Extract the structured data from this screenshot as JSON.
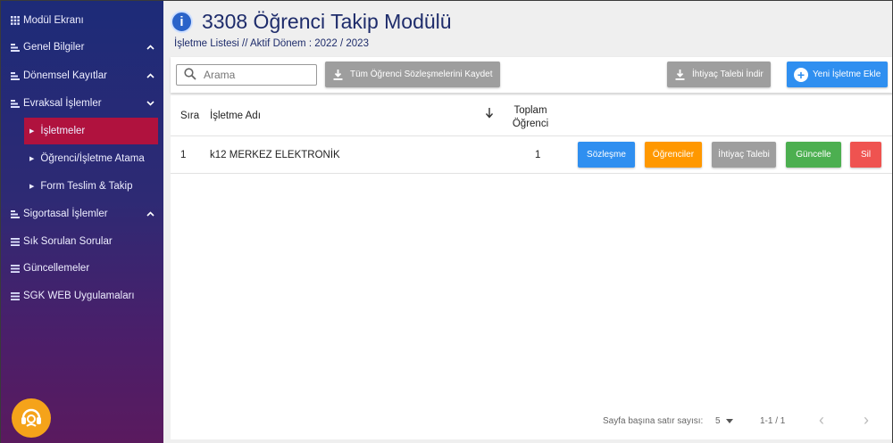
{
  "sidebar": {
    "items": [
      {
        "label": "Modül Ekranı",
        "icon": "grid-icon",
        "chevron": ""
      },
      {
        "label": "Genel Bilgiler",
        "icon": "list-icon",
        "chevron": "up"
      },
      {
        "label": "Dönemsel Kayıtlar",
        "icon": "list-icon",
        "chevron": "up"
      },
      {
        "label": "Evraksal İşlemler",
        "icon": "list-icon",
        "chevron": "down"
      }
    ],
    "subitems": [
      {
        "label": "İşletmeler",
        "active": true
      },
      {
        "label": "Öğrenci/İşletme Atama",
        "active": false
      },
      {
        "label": "Form Teslim & Takip",
        "active": false
      }
    ],
    "items2": [
      {
        "label": "Sigortasal İşlemler",
        "icon": "list-icon",
        "chevron": "up"
      },
      {
        "label": "Sık Sorulan Sorular",
        "icon": "menu-icon",
        "chevron": ""
      },
      {
        "label": "Güncellemeler",
        "icon": "menu-icon",
        "chevron": ""
      },
      {
        "label": "SGK WEB Uygulamaları",
        "icon": "menu-icon",
        "chevron": ""
      }
    ],
    "active_color": "#b0123e"
  },
  "header": {
    "title": "3308 Öğrenci Takip Modülü",
    "subtitle": "İşletme Listesi // Aktif Dönem : 2022 / 2023"
  },
  "toolbar": {
    "search_placeholder": "Arama",
    "save_all_label": "Tüm Öğrenci Sözleşmelerini Kaydet",
    "download_label": "İhtiyaç Talebi İndir",
    "new_label": "Yeni İşletme Ekle"
  },
  "table": {
    "columns": {
      "index": "Sıra",
      "name": "İşletme Adı",
      "total_line1": "Toplam",
      "total_line2": "Öğrenci"
    },
    "rows": [
      {
        "index": "1",
        "name": "k12 MERKEZ ELEKTRONİK",
        "total": "1"
      }
    ],
    "actions": {
      "contract": "Sözleşme",
      "students": "Öğrenciler",
      "request": "İhtiyaç Talebi",
      "update": "Güncelle",
      "delete": "Sil"
    },
    "action_colors": {
      "contract": "#2f8ff0",
      "students": "#ff9800",
      "request": "#9e9e9e",
      "update": "#4caf50",
      "delete": "#ef5350"
    }
  },
  "pagination": {
    "rows_per_page_label": "Sayfa başına satır sayısı:",
    "rows_per_page_value": "5",
    "range": "1-1 / 1",
    "prev": "‹",
    "next": "›"
  }
}
